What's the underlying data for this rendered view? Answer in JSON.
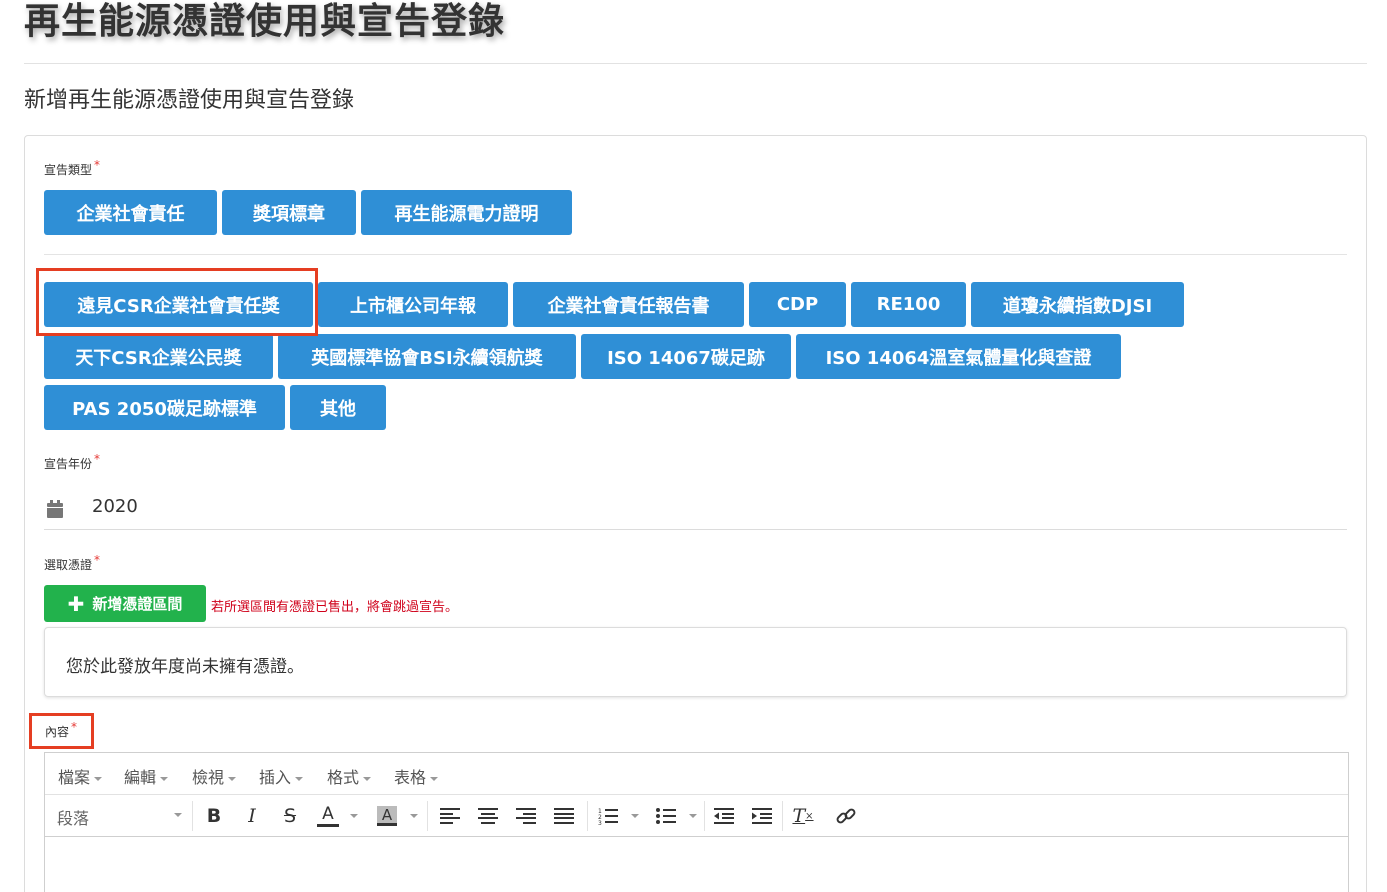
{
  "page": {
    "title": "再生能源憑證使用與宣告登錄",
    "subtitle": "新增再生能源憑證使用與宣告登錄"
  },
  "declaration_type": {
    "label": "宣告類型",
    "required_mark": "*",
    "options": [
      "企業社會責任",
      "獎項標章",
      "再生能源電力證明"
    ]
  },
  "awards": {
    "options": [
      "遠見CSR企業社會責任獎",
      "上市櫃公司年報",
      "企業社會責任報告書",
      "CDP",
      "RE100",
      "道瓊永續指數DJSI",
      "天下CSR企業公民獎",
      "英國標準協會BSI永續領航獎",
      "ISO 14067碳足跡",
      "ISO 14064溫室氣體量化與查證",
      "PAS 2050碳足跡標準",
      "其他"
    ],
    "highlighted": "遠見CSR企業社會責任獎"
  },
  "declaration_year": {
    "label": "宣告年份",
    "required_mark": "*",
    "value": "2020",
    "icon": "calendar-icon"
  },
  "certificates": {
    "label": "選取憑證",
    "required_mark": "*",
    "add_button_label": "新增憑證區間",
    "add_icon": "plus-icon",
    "warning": "若所選區間有憑證已售出，將會跳過宣告。",
    "empty_message": "您於此發放年度尚未擁有憑證。"
  },
  "content": {
    "label": "內容",
    "required_mark": "*",
    "editor": {
      "menus": [
        "檔案",
        "編輯",
        "檢視",
        "插入",
        "格式",
        "表格"
      ],
      "block_format": "段落",
      "toolbar_icons": [
        "bold-icon",
        "italic-icon",
        "strikethrough-icon",
        "text-color-icon",
        "background-color-icon",
        "align-left-icon",
        "align-center-icon",
        "align-right-icon",
        "align-justify-icon",
        "numbered-list-icon",
        "bullet-list-icon",
        "outdent-icon",
        "indent-icon",
        "clear-format-icon",
        "link-icon"
      ],
      "bold_glyph": "B",
      "italic_glyph": "I",
      "strike_glyph": "S",
      "text_color_glyph": "A",
      "bg_color_glyph": "A",
      "clear_glyph": "T"
    }
  },
  "colors": {
    "primary_button": "#2f8fd6",
    "add_button": "#22b24c",
    "warning_text": "#d0021b",
    "highlight_outline": "#e53e22",
    "required_mark": "#e53935"
  }
}
